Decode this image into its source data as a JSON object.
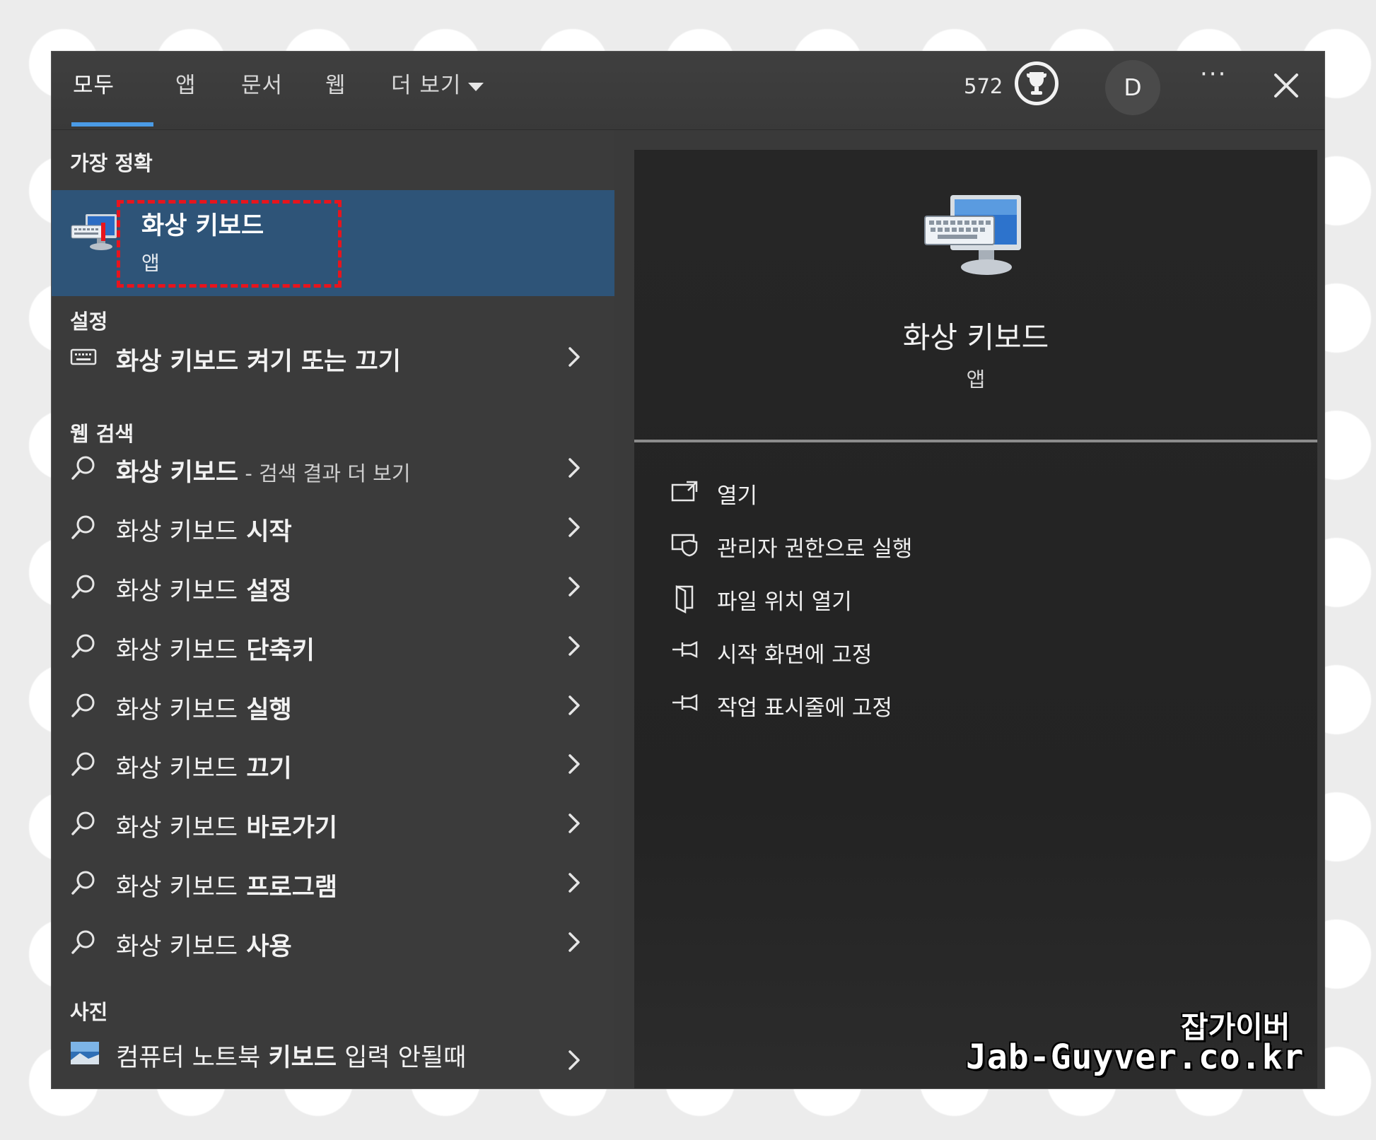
{
  "tabs": [
    {
      "label": "모두",
      "active": true
    },
    {
      "label": "앱"
    },
    {
      "label": "문서"
    },
    {
      "label": "웹"
    },
    {
      "label": "더 보기"
    }
  ],
  "header": {
    "points": "572",
    "avatar_letter": "D",
    "more_label": "···",
    "icons": [
      "trophy-icon",
      "close-icon",
      "chevron-down-icon"
    ]
  },
  "sections": {
    "best": "가장 정확",
    "settings": "설정",
    "web": "웹 검색",
    "photos": "사진"
  },
  "best_match": {
    "title": "화상 키보드",
    "subtitle": "앱",
    "highlight_color": "#e8141d"
  },
  "settings_item": {
    "prefix": "화상 키보드",
    "suffix": " 켜기 또는 끄기"
  },
  "web_items": [
    {
      "prefix": "화상 키보드",
      "suffix": " - 검색 결과 더 보기"
    },
    {
      "prefix": "화상 키보드",
      "suffix": " 시작"
    },
    {
      "prefix": "화상 키보드",
      "suffix": " 설정"
    },
    {
      "prefix": "화상 키보드",
      "suffix": " 단축키"
    },
    {
      "prefix": "화상 키보드",
      "suffix": " 실행"
    },
    {
      "prefix": "화상 키보드",
      "suffix": " 끄기"
    },
    {
      "prefix": "화상 키보드",
      "suffix": " 바로가기"
    },
    {
      "prefix": "화상 키보드",
      "suffix": " 프로그램"
    },
    {
      "prefix": "화상 키보드",
      "suffix": " 사용"
    }
  ],
  "photo_item": {
    "a": "컴퓨터 노트북 ",
    "b": "키보드",
    "c": " 입력 안될때"
  },
  "preview": {
    "title": "화상 키보드",
    "subtitle": "앱"
  },
  "actions": [
    {
      "label": "열기",
      "icon": "open-icon"
    },
    {
      "label": "관리자 권한으로 실행",
      "icon": "admin-shield-icon"
    },
    {
      "label": "파일 위치 열기",
      "icon": "file-location-icon"
    },
    {
      "label": "시작 화면에 고정",
      "icon": "pin-icon"
    },
    {
      "label": "작업 표시줄에 고정",
      "icon": "pin-icon"
    }
  ],
  "watermark": {
    "line1": "잡가이버",
    "line2": "Jab-Guyver.co.kr"
  },
  "colors": {
    "accent": "#4a9be6",
    "selected_bg": "#2e5478",
    "panel_bg": "#3b3b3b",
    "preview_bg": "#262626"
  }
}
